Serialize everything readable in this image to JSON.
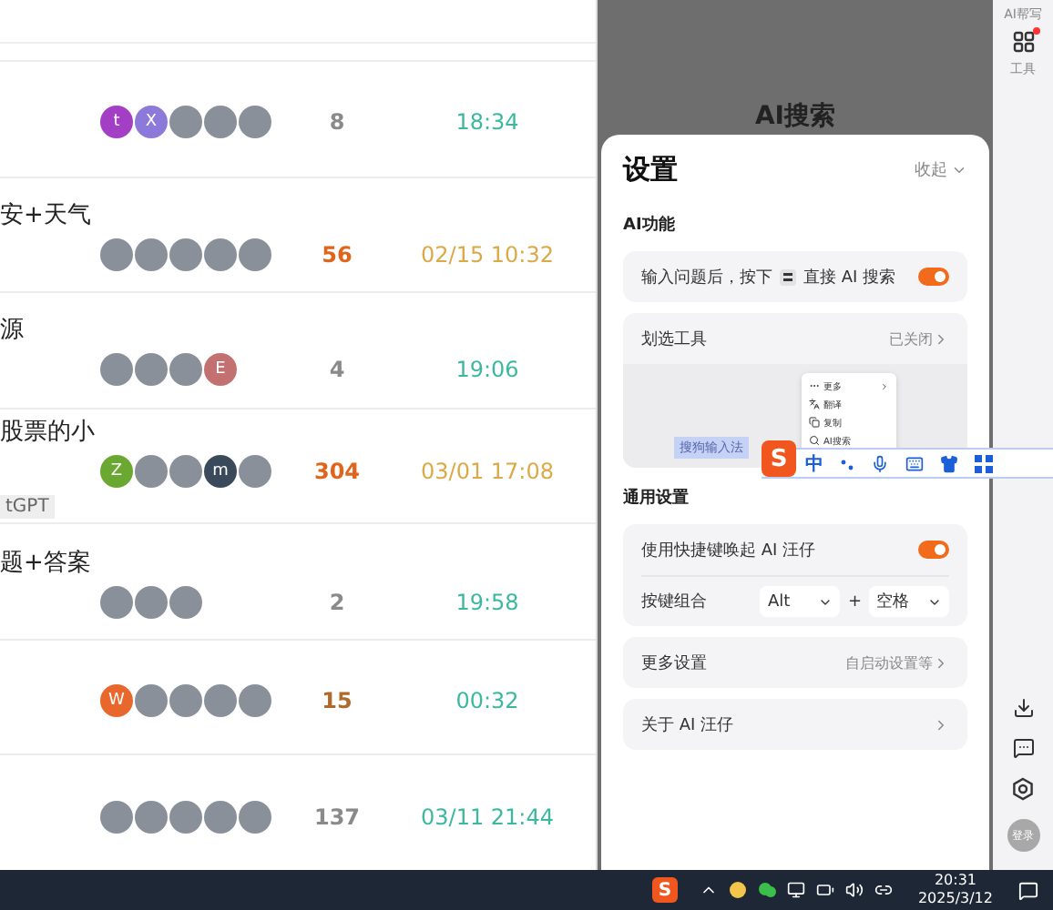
{
  "forum_list": {
    "rows": [
      {
        "avatars": [
          {
            "kind": "letter",
            "letter": "t",
            "color": "#a23fc4"
          },
          {
            "kind": "letter",
            "letter": "X",
            "color": "#8b7ad9"
          },
          {
            "kind": "photo"
          },
          {
            "kind": "photo"
          },
          {
            "kind": "photo"
          }
        ],
        "count": {
          "text": "8",
          "color": "#8a8a8a"
        },
        "time": {
          "text": "18:34",
          "color": "#3db8a0"
        }
      },
      {
        "title": "安+天气",
        "avatars": [
          {
            "kind": "photo"
          },
          {
            "kind": "photo"
          },
          {
            "kind": "photo"
          },
          {
            "kind": "photo"
          },
          {
            "kind": "photo"
          }
        ],
        "count": {
          "text": "56",
          "color": "#e0651b"
        },
        "time": {
          "text": "02/15 10:32",
          "color": "#dba946"
        }
      },
      {
        "title": "源",
        "avatars": [
          {
            "kind": "photo"
          },
          {
            "kind": "photo"
          },
          {
            "kind": "photo"
          },
          {
            "kind": "letter",
            "letter": "E",
            "color": "#c27070"
          }
        ],
        "count": {
          "text": "4",
          "color": "#8a8a8a"
        },
        "time": {
          "text": "19:06",
          "color": "#3db8a0"
        }
      },
      {
        "title": "股票的小",
        "tag": "tGPT",
        "avatars": [
          {
            "kind": "letter",
            "letter": "Z",
            "color": "#6aa832"
          },
          {
            "kind": "photo"
          },
          {
            "kind": "photo"
          },
          {
            "kind": "letter",
            "letter": "m",
            "color": "#3b4a5a"
          },
          {
            "kind": "photo"
          }
        ],
        "count": {
          "text": "304",
          "color": "#e0651b"
        },
        "time": {
          "text": "03/01 17:08",
          "color": "#dba946"
        }
      },
      {
        "title": "题+答案",
        "avatars": [
          {
            "kind": "photo"
          },
          {
            "kind": "photo"
          },
          {
            "kind": "photo"
          }
        ],
        "count": {
          "text": "2",
          "color": "#8a8a8a"
        },
        "time": {
          "text": "19:58",
          "color": "#3db8a0"
        }
      },
      {
        "avatars": [
          {
            "kind": "letter",
            "letter": "W",
            "color": "#e8672c"
          },
          {
            "kind": "photo"
          },
          {
            "kind": "photo"
          },
          {
            "kind": "photo"
          },
          {
            "kind": "photo"
          }
        ],
        "count": {
          "text": "15",
          "color": "#b06a2c"
        },
        "time": {
          "text": "00:32",
          "color": "#3db8a0"
        }
      },
      {
        "avatars": [
          {
            "kind": "photo"
          },
          {
            "kind": "photo"
          },
          {
            "kind": "photo"
          },
          {
            "kind": "photo"
          },
          {
            "kind": "photo"
          }
        ],
        "count": {
          "text": "137",
          "color": "#8a8a8a"
        },
        "time": {
          "text": "03/11 21:44",
          "color": "#3db8a0"
        }
      }
    ]
  },
  "background_title": "AI搜索",
  "settings_panel": {
    "title": "设置",
    "collapse": "收起",
    "sections": [
      {
        "heading": "AI功能",
        "cards": [
          {
            "rows": [
              {
                "kind": "toggle",
                "label": "输入问题后，按下",
                "label_2": "直接 AI 搜索",
                "on": true
              }
            ]
          },
          {
            "rows": [
              {
                "kind": "link",
                "label": "划选工具",
                "value": "已关闭"
              },
              {
                "kind": "preview",
                "selection": "搜狗输入法",
                "menu": [
                  {
                    "kind": "more",
                    "label": "更多"
                  },
                  {
                    "kind": "translate",
                    "label": "翻译"
                  },
                  {
                    "kind": "copy",
                    "label": "复制"
                  },
                  {
                    "kind": "search",
                    "label": "AI搜索"
                  }
                ]
              }
            ]
          }
        ]
      },
      {
        "heading": "通用设置",
        "cards": [
          {
            "rows": [
              {
                "kind": "toggle",
                "label": "使用快捷键唤起 AI 汪仔",
                "on": true
              },
              {
                "kind": "keys",
                "label": "按键组合",
                "key_1": "Alt",
                "joiner": "+",
                "key_2": "空格"
              }
            ]
          },
          {
            "rows": [
              {
                "kind": "link",
                "label": "更多设置",
                "value": "自启动设置等"
              }
            ]
          },
          {
            "rows": [
              {
                "kind": "link",
                "label": "关于 AI 汪仔"
              }
            ]
          }
        ]
      }
    ]
  },
  "sidebar": {
    "top_label": "AI帮写",
    "tool_label": "工具",
    "tool_badge": true,
    "login": "登录"
  },
  "ime_bar": {
    "logo": "S",
    "mode": "中"
  },
  "taskbar": {
    "logo": "S",
    "time": "20:31",
    "date": "2025/3/12"
  }
}
